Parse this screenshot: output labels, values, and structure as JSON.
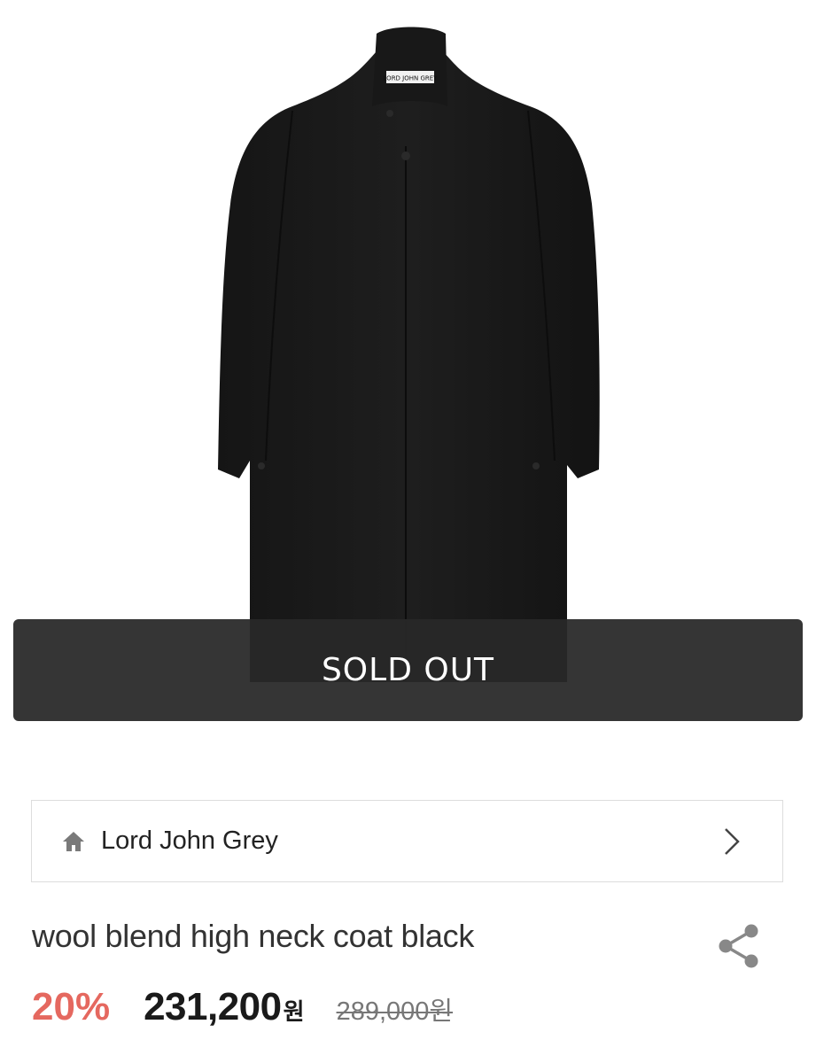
{
  "product": {
    "status_overlay": "SOLD OUT",
    "brand": {
      "name": "Lord John Grey",
      "collar_tag": "LORD JOHN GREY"
    },
    "title": "wool blend high neck coat black",
    "pricing": {
      "discount": "20%",
      "price": "231,200",
      "price_unit": "원",
      "original_price": "289,000원"
    }
  },
  "icons": {
    "brand_home": "home-icon",
    "brand_go": "chevron-right-icon",
    "share": "share-icon"
  },
  "colors": {
    "discount": "#e5685f",
    "overlay_bg": "#282828",
    "price": "#1a1a1a",
    "strikethrough": "#777777"
  }
}
